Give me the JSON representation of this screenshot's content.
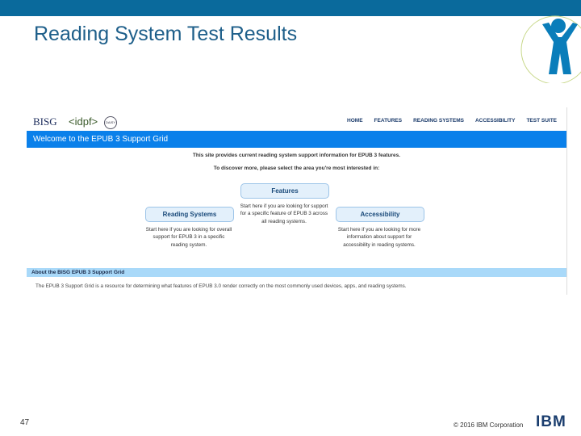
{
  "slide": {
    "title": "Reading System Test Results",
    "page_number": "47",
    "copyright": "© 2016 IBM Corporation",
    "ibm_logo": "IBM"
  },
  "site": {
    "logos": [
      "BISG",
      "<idpf>",
      "DAISY"
    ],
    "nav": [
      "HOME",
      "FEATURES",
      "READING SYSTEMS",
      "ACCESSIBILITY",
      "TEST SUITE"
    ],
    "welcome": "Welcome to the EPUB 3 Support Grid",
    "intro1": "This site provides current reading system support information for EPUB 3 features.",
    "intro2": "To discover more, please select the area you're most interested in:",
    "features": {
      "label": "Features",
      "desc": "Start here if you are looking for support for a specific feature of EPUB 3 across all reading systems."
    },
    "reading_systems": {
      "label": "Reading Systems",
      "desc": "Start here if you are looking for overall support for EPUB 3 in a specific reading system."
    },
    "accessibility": {
      "label": "Accessibility",
      "desc": "Start here if you are looking for more information about support for accessibility in reading systems."
    },
    "about_title": "About the BISG EPUB 3 Support Grid",
    "about_text": "The EPUB 3 Support Grid is a resource for determining what features of EPUB 3.0 render correctly on the most commonly used devices, apps, and reading systems."
  }
}
